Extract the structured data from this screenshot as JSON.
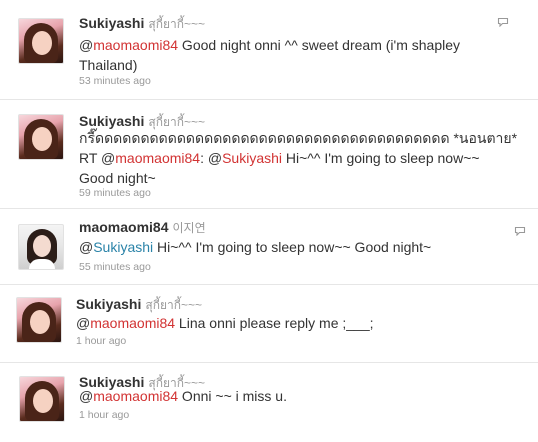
{
  "tweets": [
    {
      "name": "Sukiyashi",
      "full_name": "สุกี้ยากี้~~~",
      "lines": [
        [
          {
            "text": "@"
          },
          {
            "text": "maomaomi84",
            "type": "mention"
          },
          {
            "text": " Good night onni ^^ sweet dream (i'm shapley"
          }
        ],
        [
          {
            "text": "Thailand)"
          }
        ]
      ],
      "time": "53 minutes ago"
    },
    {
      "name": "Sukiyashi",
      "full_name": "สุกี้ยากี้~~~",
      "lines": [
        [
          {
            "text": "กรี๊ดดดดดดดดดดดดดดดดดดดดดดดดดดดดดดดดดดดดดดด *นอนตาย*"
          }
        ],
        [
          {
            "text": "RT @"
          },
          {
            "text": "maomaomi84",
            "type": "mention"
          },
          {
            "text": ": @"
          },
          {
            "text": "Sukiyashi",
            "type": "mention"
          },
          {
            "text": " Hi~^^ I'm going to sleep now~~"
          }
        ],
        [
          {
            "text": "Good night~"
          }
        ]
      ],
      "time": "59 minutes ago"
    },
    {
      "name": "maomaomi84",
      "full_name": "이지연",
      "lines": [
        [
          {
            "text": "@"
          },
          {
            "text": "Sukiyashi",
            "type": "mention-blue"
          },
          {
            "text": " Hi~^^ I'm going to sleep now~~ Good night~"
          }
        ]
      ],
      "time": "55 minutes ago"
    },
    {
      "name": "Sukiyashi",
      "full_name": "สุกี้ยากี้~~~",
      "lines": [
        [
          {
            "text": "@"
          },
          {
            "text": "maomaomi84",
            "type": "mention"
          },
          {
            "text": " Lina onni please reply me ;___;"
          }
        ]
      ],
      "time": "1 hour ago"
    },
    {
      "name": "Sukiyashi",
      "full_name": "สุกี้ยากี้~~~",
      "lines": [
        [
          {
            "text": "@"
          },
          {
            "text": "maomaomi84",
            "type": "mention"
          },
          {
            "text": " Onni ~~ i miss u."
          }
        ]
      ],
      "time": "1 hour ago"
    }
  ],
  "icons": {
    "avatar_a": "avatar-photo-icon",
    "avatar_b": "avatar-photo-icon",
    "reply": "reply-icon"
  }
}
